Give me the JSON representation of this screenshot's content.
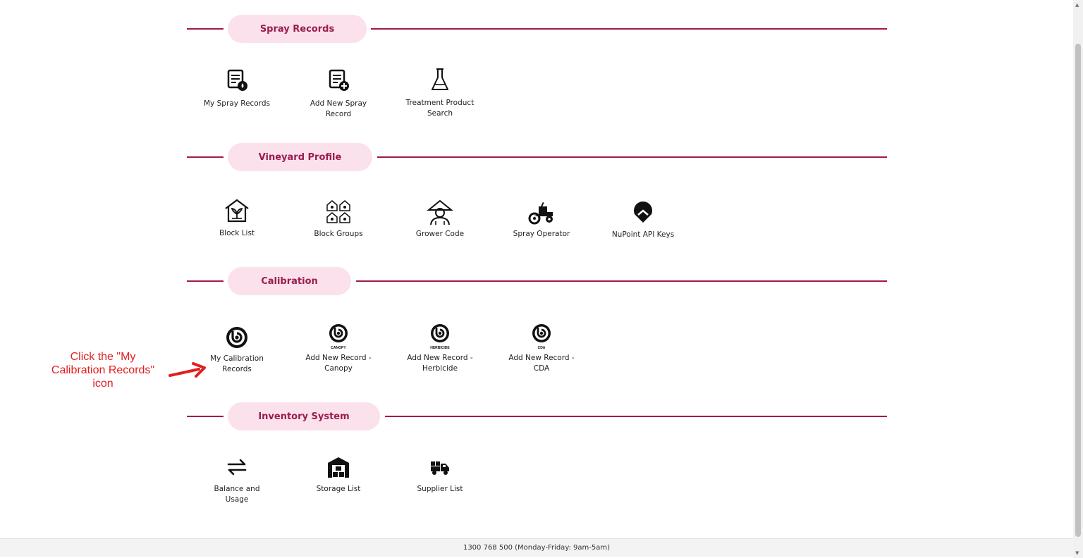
{
  "sections": [
    {
      "title": "Spray Records",
      "tiles": [
        {
          "label": "My Spray Records",
          "icon": "spray-records-icon"
        },
        {
          "label": "Add New Spray Record",
          "icon": "add-spray-record-icon"
        },
        {
          "label": "Treatment Product Search",
          "icon": "flask-icon"
        }
      ]
    },
    {
      "title": "Vineyard Profile",
      "tiles": [
        {
          "label": "Block List",
          "icon": "greenhouse-icon"
        },
        {
          "label": "Block Groups",
          "icon": "block-groups-icon"
        },
        {
          "label": "Grower Code",
          "icon": "farmer-icon"
        },
        {
          "label": "Spray Operator",
          "icon": "tractor-icon"
        },
        {
          "label": "NuPoint API Keys",
          "icon": "location-pin-icon"
        }
      ]
    },
    {
      "title": "Calibration",
      "tiles": [
        {
          "label": "My Calibration Records",
          "icon": "calibration-icon"
        },
        {
          "label": "Add New Record - Canopy",
          "icon": "calibration-canopy-icon",
          "sublabel": "CANOPY"
        },
        {
          "label": "Add New Record - Herbicide",
          "icon": "calibration-herbicide-icon",
          "sublabel": "HERBICIDE"
        },
        {
          "label": "Add New Record - CDA",
          "icon": "calibration-cda-icon",
          "sublabel": "CDA"
        }
      ]
    },
    {
      "title": "Inventory System",
      "tiles": [
        {
          "label": "Balance and Usage",
          "icon": "swap-arrows-icon"
        },
        {
          "label": "Storage List",
          "icon": "warehouse-icon"
        },
        {
          "label": "Supplier List",
          "icon": "delivery-truck-icon"
        }
      ]
    }
  ],
  "annotation": {
    "text": "Click the \"My Calibration Records\" icon",
    "color": "#e02020"
  },
  "footer": {
    "text": "1300 768 500 (Monday-Friday: 9am-5am)"
  },
  "colors": {
    "accent": "#a3174f",
    "pill": "#fbe1ec"
  }
}
